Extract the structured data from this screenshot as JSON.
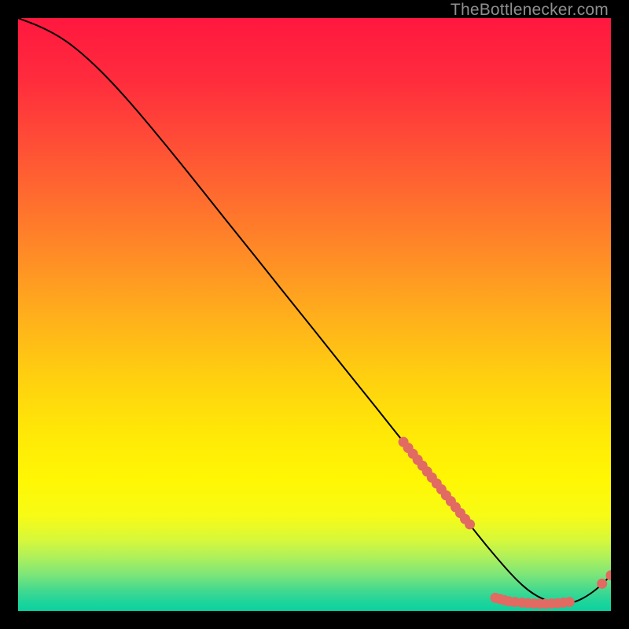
{
  "watermark": "TheBottlenecker.com",
  "chart_data": {
    "type": "line",
    "title": "",
    "xlabel": "",
    "ylabel": "",
    "xlim": [
      0,
      100
    ],
    "ylim": [
      0,
      100
    ],
    "series": [
      {
        "name": "curve",
        "x": [
          0,
          4,
          8,
          12,
          16,
          20,
          25,
          30,
          35,
          40,
          45,
          50,
          55,
          60,
          65,
          70,
          73,
          76,
          79,
          82,
          84,
          86,
          88,
          90,
          92,
          94,
          96,
          98,
          100
        ],
        "y": [
          100,
          98.5,
          96.3,
          93.0,
          89.0,
          84.5,
          78.5,
          72.3,
          66.0,
          59.8,
          53.5,
          47.3,
          41.0,
          34.8,
          28.5,
          22.3,
          18.5,
          14.8,
          11.0,
          7.5,
          5.3,
          3.5,
          2.2,
          1.5,
          1.2,
          1.5,
          2.5,
          4.0,
          6.0
        ]
      }
    ],
    "points": [
      {
        "x": 65.0,
        "y": 28.5
      },
      {
        "x": 65.8,
        "y": 27.5
      },
      {
        "x": 66.6,
        "y": 26.5
      },
      {
        "x": 67.4,
        "y": 25.5
      },
      {
        "x": 68.2,
        "y": 24.5
      },
      {
        "x": 69.0,
        "y": 23.5
      },
      {
        "x": 69.8,
        "y": 22.5
      },
      {
        "x": 70.6,
        "y": 21.5
      },
      {
        "x": 71.4,
        "y": 20.5
      },
      {
        "x": 72.2,
        "y": 19.5
      },
      {
        "x": 73.0,
        "y": 18.5
      },
      {
        "x": 73.8,
        "y": 17.5
      },
      {
        "x": 74.6,
        "y": 16.5
      },
      {
        "x": 75.4,
        "y": 15.5
      },
      {
        "x": 76.2,
        "y": 14.6
      },
      {
        "x": 80.5,
        "y": 2.2
      },
      {
        "x": 81.3,
        "y": 2.0
      },
      {
        "x": 82.0,
        "y": 1.8
      },
      {
        "x": 82.8,
        "y": 1.6
      },
      {
        "x": 83.8,
        "y": 1.5
      },
      {
        "x": 85.0,
        "y": 1.4
      },
      {
        "x": 86.0,
        "y": 1.3
      },
      {
        "x": 87.0,
        "y": 1.25
      },
      {
        "x": 88.0,
        "y": 1.2
      },
      {
        "x": 89.0,
        "y": 1.2
      },
      {
        "x": 90.0,
        "y": 1.25
      },
      {
        "x": 91.0,
        "y": 1.3
      },
      {
        "x": 92.0,
        "y": 1.4
      },
      {
        "x": 93.0,
        "y": 1.5
      },
      {
        "x": 98.5,
        "y": 4.6
      },
      {
        "x": 100.0,
        "y": 6.0
      }
    ],
    "gradient_stops": [
      {
        "offset": 0.0,
        "color": "#ff173f"
      },
      {
        "offset": 0.1,
        "color": "#ff2b3d"
      },
      {
        "offset": 0.2,
        "color": "#ff4a37"
      },
      {
        "offset": 0.3,
        "color": "#ff6b2f"
      },
      {
        "offset": 0.4,
        "color": "#ff8c26"
      },
      {
        "offset": 0.5,
        "color": "#ffae1c"
      },
      {
        "offset": 0.6,
        "color": "#ffce10"
      },
      {
        "offset": 0.7,
        "color": "#ffe807"
      },
      {
        "offset": 0.78,
        "color": "#fff704"
      },
      {
        "offset": 0.84,
        "color": "#f7fb16"
      },
      {
        "offset": 0.88,
        "color": "#d7f83a"
      },
      {
        "offset": 0.91,
        "color": "#aef05c"
      },
      {
        "offset": 0.94,
        "color": "#7ae57a"
      },
      {
        "offset": 0.965,
        "color": "#44d98f"
      },
      {
        "offset": 0.985,
        "color": "#1ed49a"
      },
      {
        "offset": 1.0,
        "color": "#0bd2a0"
      }
    ]
  }
}
